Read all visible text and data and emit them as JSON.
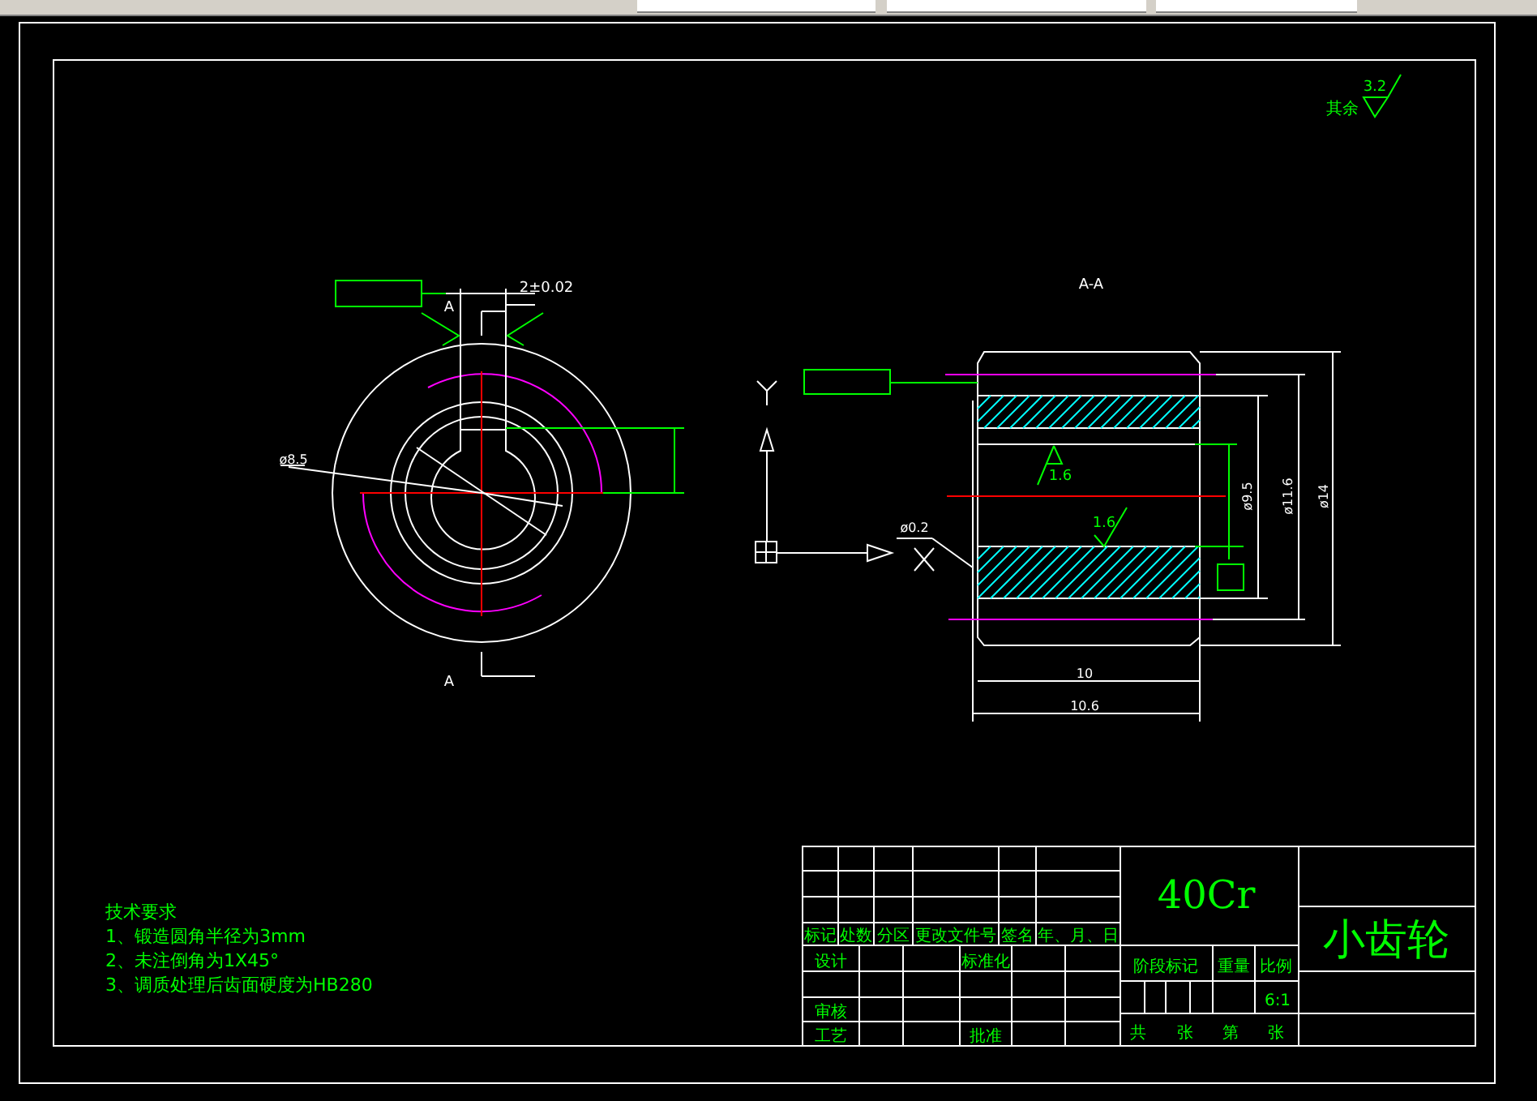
{
  "surface_finish_note": {
    "label": "其余",
    "value": "3.2"
  },
  "front_view": {
    "section_marks": [
      "A",
      "A"
    ],
    "tolerance": "2±0.02",
    "diameter": "ø8.5"
  },
  "section_view": {
    "title": "A-A",
    "roughness": [
      "1.6",
      "1.6"
    ],
    "chamfer": "ø0.2",
    "diameters": [
      "ø9.5",
      "ø11.6",
      "ø14"
    ],
    "lengths": [
      "10",
      "10.6"
    ]
  },
  "tech_requirements": {
    "title": "技术要求",
    "items": [
      "1、锻造圆角半径为3mm",
      "2、未注倒角为1X45°",
      "3、调质处理后齿面硬度为HB280"
    ]
  },
  "title_block": {
    "material": "40Cr",
    "part_name": "小齿轮",
    "headers": [
      "标记",
      "处数",
      "分区",
      "更改文件号",
      "签名",
      "年、月、日"
    ],
    "signoff": [
      "设计",
      "标准化",
      "审核",
      "工艺",
      "批准"
    ],
    "stage": "阶段标记",
    "weight": "重量",
    "scale_label": "比例",
    "scale": "6:1",
    "sheet": [
      "共",
      "张",
      "第",
      "张"
    ]
  }
}
